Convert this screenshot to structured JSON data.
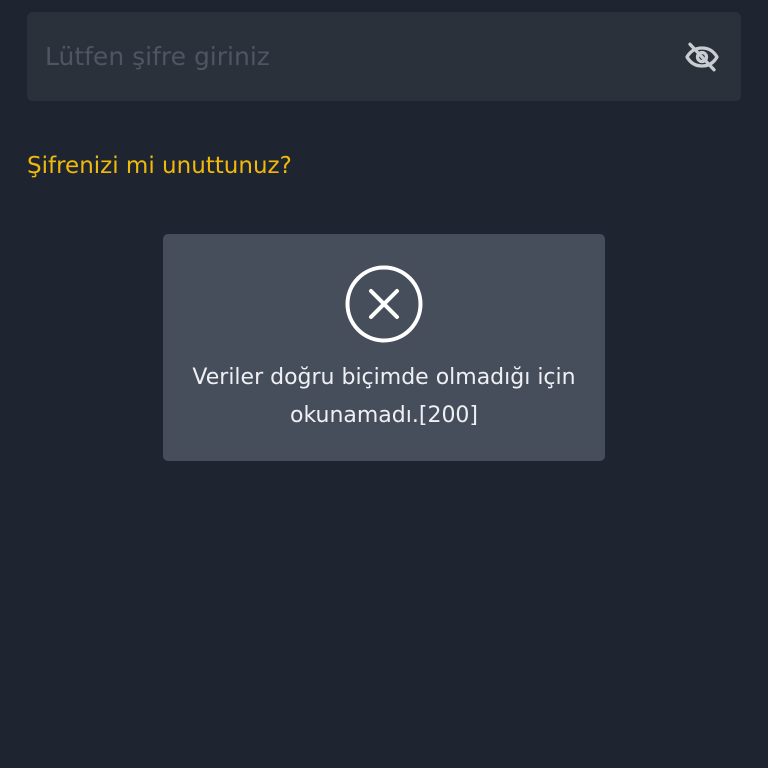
{
  "password_field": {
    "placeholder": "Lütfen şifre giriniz",
    "value": "",
    "toggle_icon": "eye-off-icon"
  },
  "forgot_password": {
    "label": "Şifrenizi mi unuttunuz?"
  },
  "error_toast": {
    "icon": "close-circle-icon",
    "message_line1": "Veriler doğru biçimde olmadığı için",
    "message_line2": "okunamadı.[200]"
  },
  "colors": {
    "background": "#1f2530",
    "input_background": "#2b313b",
    "accent": "#f0b90b",
    "toast_background": "#474e5b",
    "text": "#eef0f3"
  }
}
